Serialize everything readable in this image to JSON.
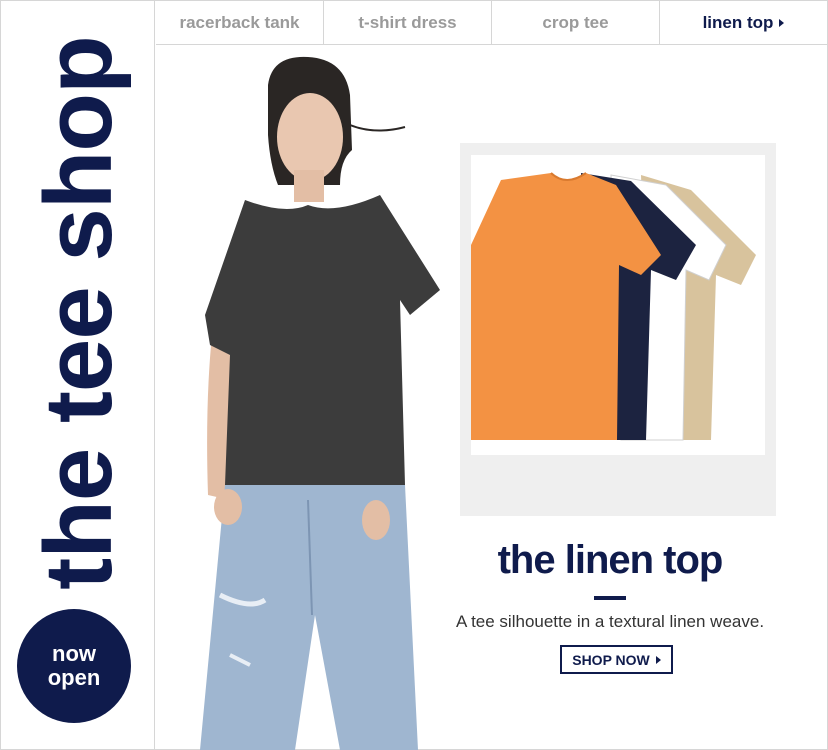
{
  "banner": {
    "vertical_title": "the tee shop",
    "badge_line1": "now",
    "badge_line2": "open"
  },
  "nav": {
    "items": [
      {
        "label": "racerback tank",
        "active": false
      },
      {
        "label": "t-shirt dress",
        "active": false
      },
      {
        "label": "crop tee",
        "active": false
      },
      {
        "label": "linen top",
        "active": true
      }
    ]
  },
  "feature": {
    "headline": "the linen top",
    "subcopy": "A tee silhouette in a textural linen weave.",
    "cta_label": "SHOP NOW"
  },
  "colors": {
    "brand_navy": "#0f1b4c",
    "nav_inactive": "#9a9a9a",
    "panel_gray": "#efefef",
    "tee_orange": "#f39243",
    "tee_navy": "#1c2340",
    "tee_white": "#ffffff",
    "tee_khaki": "#d8c39d",
    "model_top": "#3c3c3c",
    "model_jeans": "#9fb6d0"
  },
  "icons": {
    "nav_active_caret": "caret-right-icon",
    "cta_caret": "caret-right-icon"
  }
}
